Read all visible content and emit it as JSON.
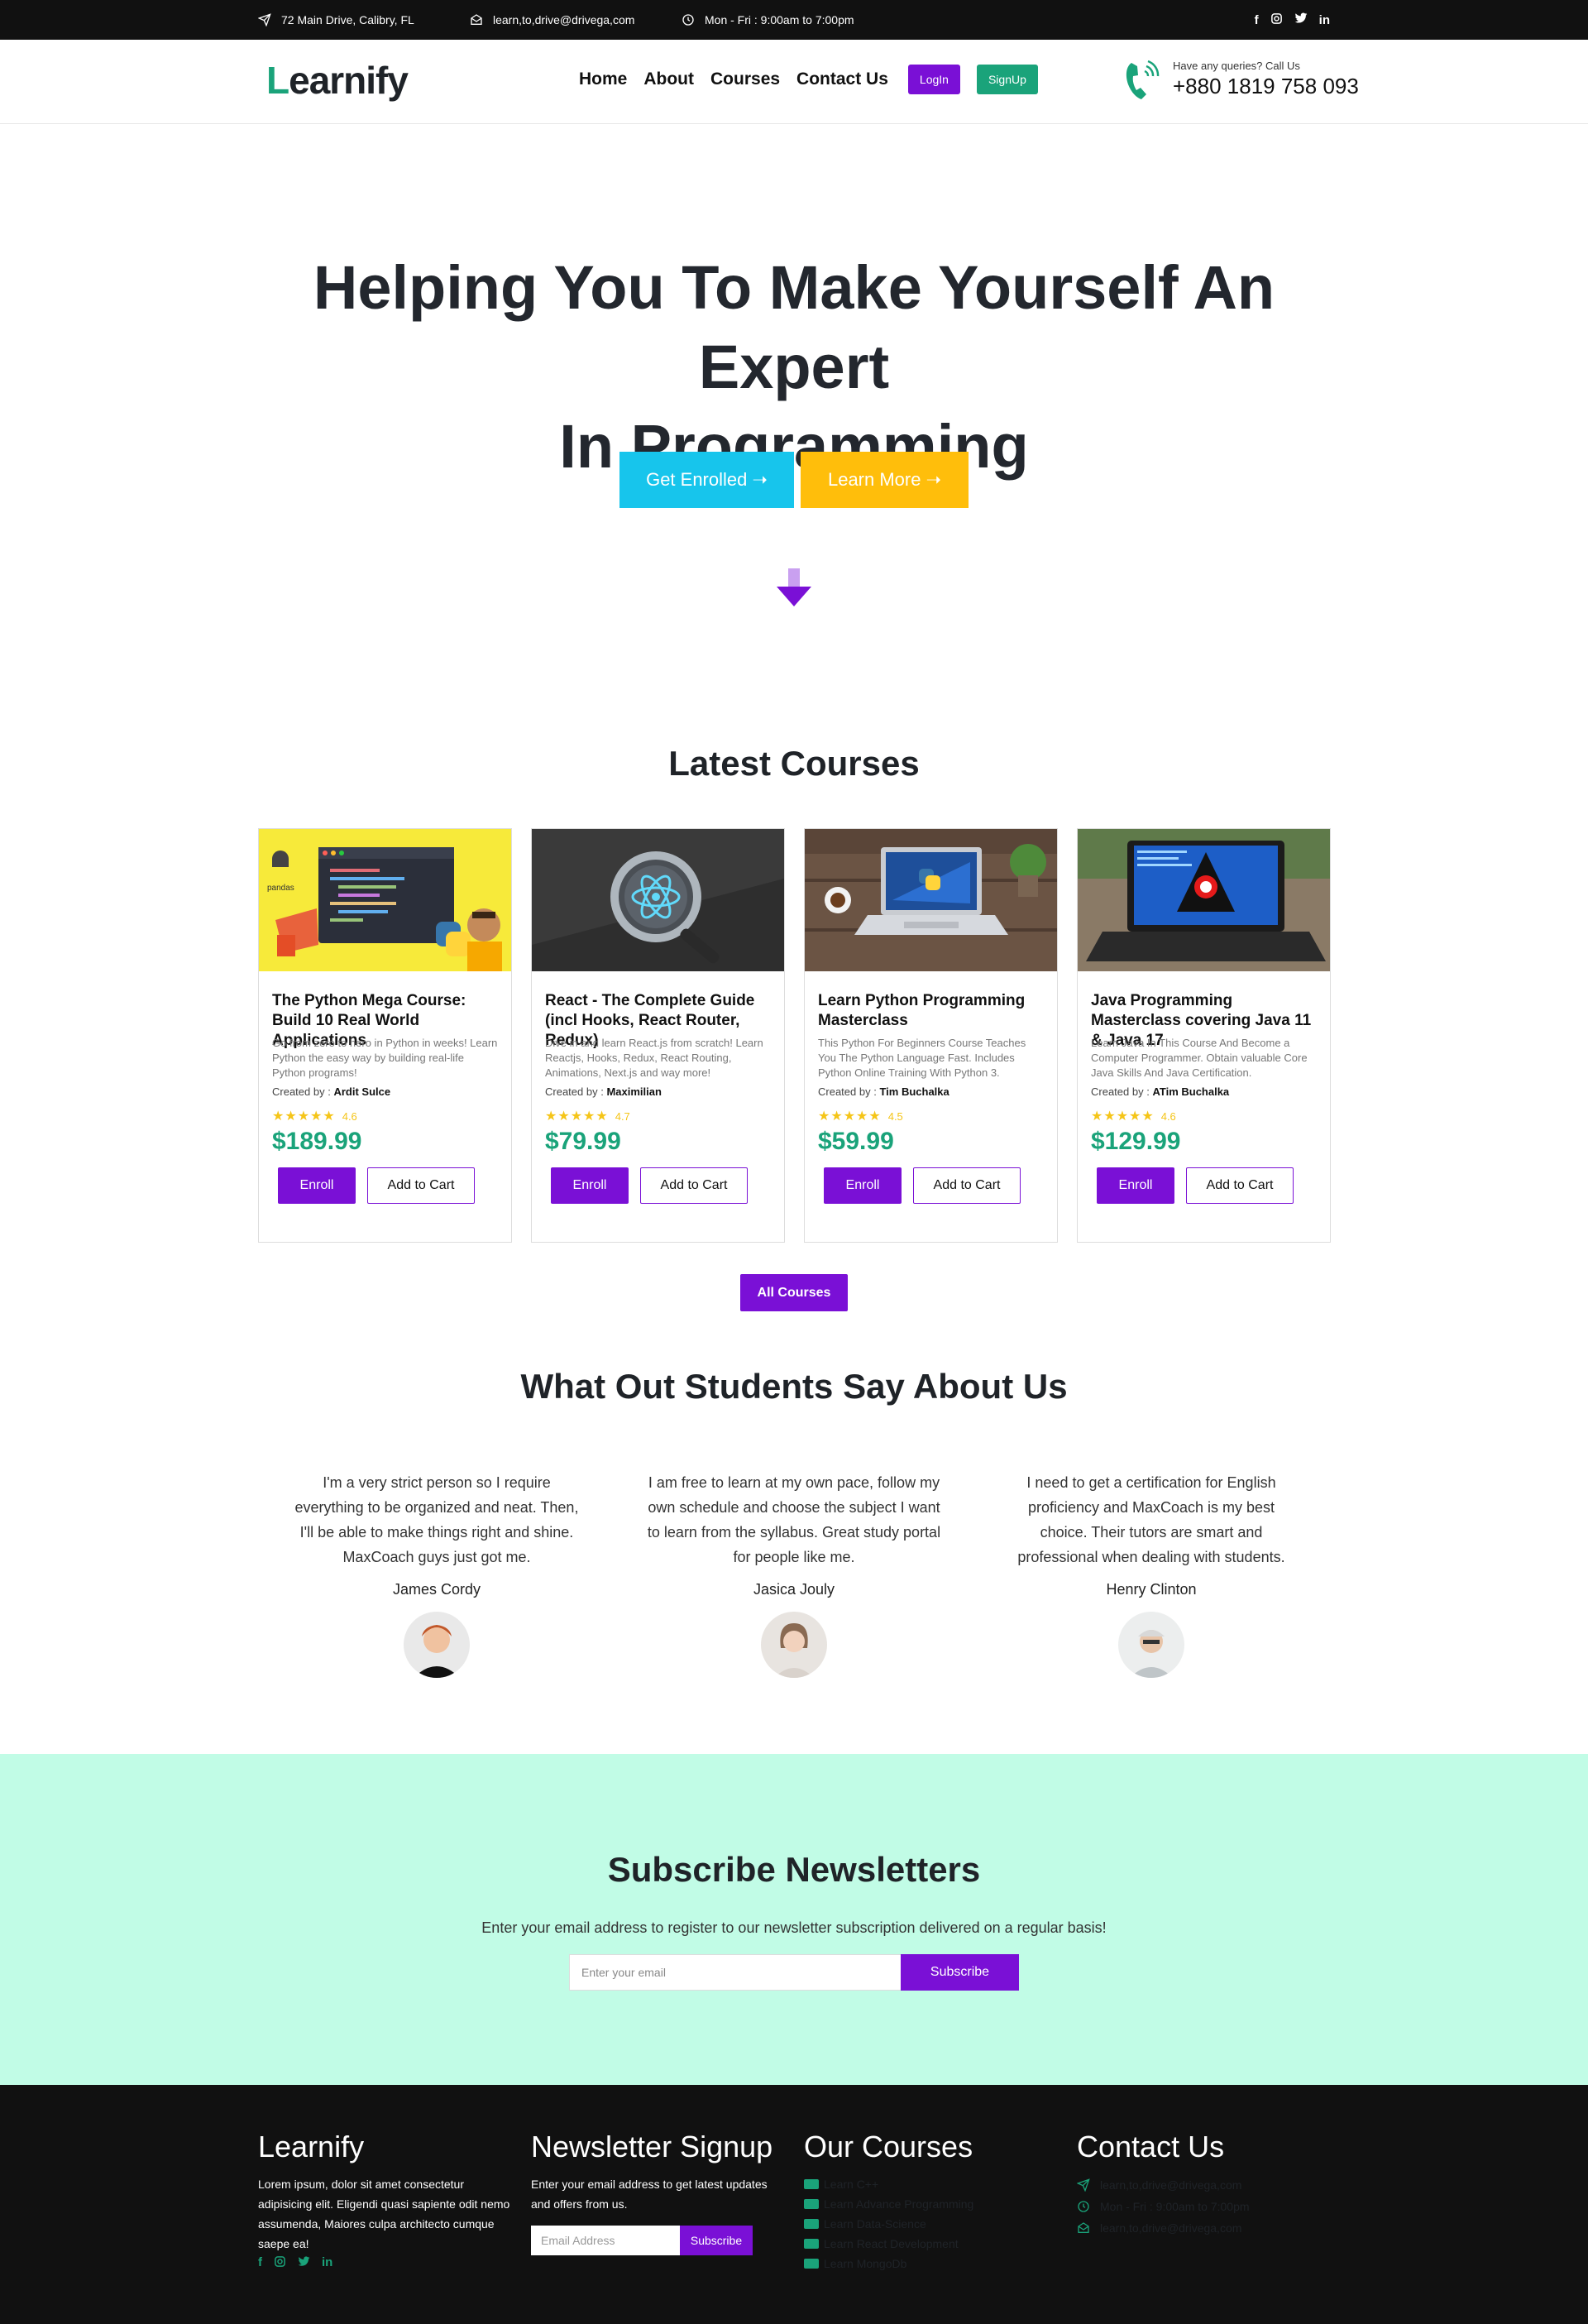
{
  "colors": {
    "accent": "#7a10d6",
    "brand_green": "#1aa37a",
    "cyan": "#17c5ec",
    "yellow": "#ffbe0b",
    "mint": "#c1fce6"
  },
  "topbar": {
    "address": "72 Main Drive, Calibry, FL",
    "email": "learn,to,drive@drivega,com",
    "hours": "Mon - Fri : 9:00am to 7:00pm",
    "social": [
      "f",
      "ig",
      "tw",
      "in"
    ]
  },
  "nav": {
    "logo_first": "L",
    "logo_rest": "earnify",
    "items": [
      "Home",
      "About",
      "Courses",
      "Contact Us"
    ],
    "login": "LogIn",
    "signup": "SignUp",
    "call_label": "Have any queries? Call Us",
    "phone": "+880 1819 758 093"
  },
  "hero": {
    "title_line1": "Helping You To Make Yourself An Expert",
    "title_line2": "In Programming",
    "enroll_btn": "Get Enrolled ➝",
    "learn_btn": "Learn More ➝"
  },
  "courses": {
    "title": "Latest Courses",
    "created_by_label": "Created by :",
    "enroll_label": "Enroll",
    "cart_label": "Add to Cart",
    "all_btn": "All Courses",
    "items": [
      {
        "title": "The Python Mega Course: Build 10 Real World Applications",
        "desc": "Go from zero to hero in Python in weeks! Learn Python the easy way by building real-life Python programs!",
        "author": "Ardit Sulce",
        "rating": "4.6",
        "price": "$189.99",
        "thumb_icon": "python-code-screen-icon"
      },
      {
        "title": "React - The Complete Guide (incl Hooks, React Router, Redux)",
        "desc": "Dive in and learn React.js from scratch! Learn Reactjs, Hooks, Redux, React Routing, Animations, Next.js and way more!",
        "author": "Maximilian",
        "rating": "4.7",
        "price": "$79.99",
        "thumb_icon": "react-magnifier-icon"
      },
      {
        "title": "Learn Python Programming Masterclass",
        "desc": "This Python For Beginners Course Teaches You The Python Language Fast. Includes Python Online Training With Python 3.",
        "author": "Tim Buchalka",
        "rating": "4.5",
        "price": "$59.99",
        "thumb_icon": "laptop-python-icon"
      },
      {
        "title": "Java Programming Masterclass covering Java 11 & Java 17",
        "desc": "Learn Java In This Course And Become a Computer Programmer. Obtain valuable Core Java Skills And Java Certification.",
        "author": "ATim Buchalka",
        "rating": "4.6",
        "price": "$129.99",
        "thumb_icon": "laptop-java-icon"
      }
    ]
  },
  "testimonials": {
    "title": "What Out Students Say About Us",
    "items": [
      {
        "quote": "I'm a very strict person so I require everything to be organized and neat. Then, I'll be able to make things right and shine. MaxCoach guys just got me.",
        "name": "James Cordy"
      },
      {
        "quote": "I am free to learn at my own pace, follow my own schedule and choose the subject I want to learn from the syllabus. Great study portal for people like me.",
        "name": "Jasica Jouly"
      },
      {
        "quote": "I need to get a certification for English proficiency and MaxCoach is my best choice. Their tutors are smart and professional when dealing with students.",
        "name": "Henry Clinton"
      }
    ]
  },
  "subscribe": {
    "title": "Subscribe Newsletters",
    "desc": "Enter your email address to register to our newsletter subscription delivered on a regular basis!",
    "placeholder": "Enter your email",
    "button": "Subscribe"
  },
  "footer": {
    "brand": "Learnify",
    "brand_text": "Lorem ipsum, dolor sit amet consectetur adipisicing elit. Eligendi quasi sapiente odit nemo assumenda, Maiores culpa architecto cumque saepe ea!",
    "social": [
      "f",
      "ig",
      "tw",
      "in"
    ],
    "news_title": "Newsletter Signup",
    "news_text": "Enter your email address to get latest updates and offers from us.",
    "news_placeholder": "Email Address",
    "news_button": "Subscribe",
    "courses_title": "Our Courses",
    "courses": [
      "Learn C++",
      "Learn Advance Programming",
      "Learn Data-Science",
      "Learn React Development",
      "Learn MongoDb"
    ],
    "contact_title": "Contact Us",
    "contact": [
      "learn,to,drive@drivega,com",
      "Mon - Fri : 9:00am to 7:00pm",
      "learn,to,drive@drivega,com"
    ]
  }
}
